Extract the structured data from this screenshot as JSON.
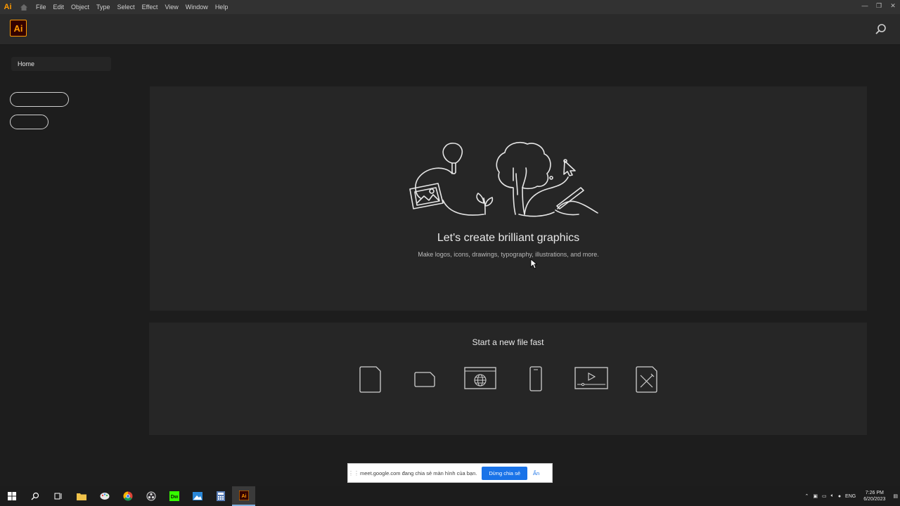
{
  "menubar": {
    "logo": "Ai",
    "items": [
      "File",
      "Edit",
      "Object",
      "Type",
      "Select",
      "Effect",
      "View",
      "Window",
      "Help"
    ]
  },
  "appbar": {
    "logo": "Ai"
  },
  "sidebar": {
    "home_label": "Home"
  },
  "hero": {
    "title": "Let's create brilliant graphics",
    "subtitle": "Make logos, icons, drawings, typography, illustrations, and more."
  },
  "start": {
    "title": "Start a new file fast",
    "presets": [
      "document-icon",
      "tablet-icon",
      "web-icon",
      "mobile-icon",
      "video-icon",
      "art-illustration-icon"
    ]
  },
  "share_bar": {
    "text": "meet.google.com đang chia sẻ màn hình của bạn.",
    "stop_label": "Dừng chia sẻ",
    "hide_label": "Ẩn"
  },
  "taskbar": {
    "tray_lang": "ENG",
    "time": "7:26 PM",
    "date": "6/20/2023"
  },
  "colors": {
    "accent": "#ff9a00",
    "background": "#1d1d1d",
    "panel": "#262626",
    "share_button": "#1a73e8"
  }
}
